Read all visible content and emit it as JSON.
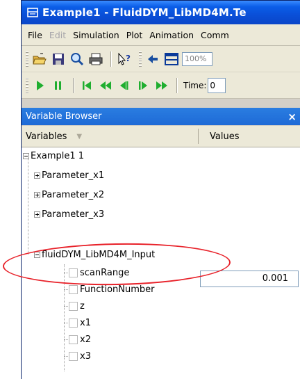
{
  "window": {
    "title": "Example1 - FluidDYM_LibMD4M.Te"
  },
  "menu": {
    "items": [
      {
        "label": "File",
        "enabled": true
      },
      {
        "label": "Edit",
        "enabled": false
      },
      {
        "label": "Simulation",
        "enabled": true
      },
      {
        "label": "Plot",
        "enabled": true
      },
      {
        "label": "Animation",
        "enabled": true
      },
      {
        "label": "Comm",
        "enabled": true
      }
    ]
  },
  "toolbar": {
    "zoom_value": "100%",
    "time_label": "Time:",
    "time_value": "0"
  },
  "variable_browser": {
    "title": "Variable Browser",
    "close_label": "×",
    "columns": {
      "variables": "Variables",
      "values": "Values"
    },
    "tree": {
      "root": "Example1 1",
      "children": [
        {
          "label": "Parameter_x1"
        },
        {
          "label": "Parameter_x2"
        },
        {
          "label": "Parameter_x3"
        },
        {
          "label": "fluidDYM_LibMD4M_Input"
        }
      ],
      "input_children": [
        {
          "label": "scanRange",
          "value": "0.001"
        },
        {
          "label": "FunctionNumber"
        },
        {
          "label": "z"
        },
        {
          "label": "x1"
        },
        {
          "label": "x2"
        },
        {
          "label": "x3"
        }
      ]
    }
  },
  "highlight": {
    "color": "#e8222a"
  }
}
